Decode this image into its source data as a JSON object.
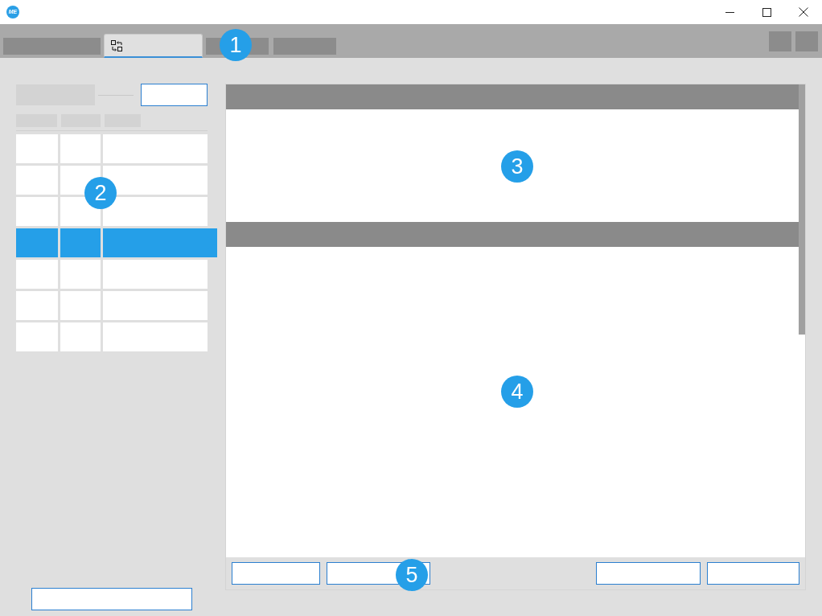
{
  "window": {
    "logo": "ME"
  },
  "tabs": [
    {
      "selected": false
    },
    {
      "selected": true
    },
    {
      "selected": false
    },
    {
      "selected": false
    }
  ],
  "list": {
    "rows": [
      {
        "selected": false
      },
      {
        "selected": false
      },
      {
        "selected": false
      },
      {
        "selected": true
      },
      {
        "selected": false
      },
      {
        "selected": false
      },
      {
        "selected": false
      }
    ]
  },
  "callouts": [
    "1",
    "2",
    "3",
    "4",
    "5"
  ]
}
